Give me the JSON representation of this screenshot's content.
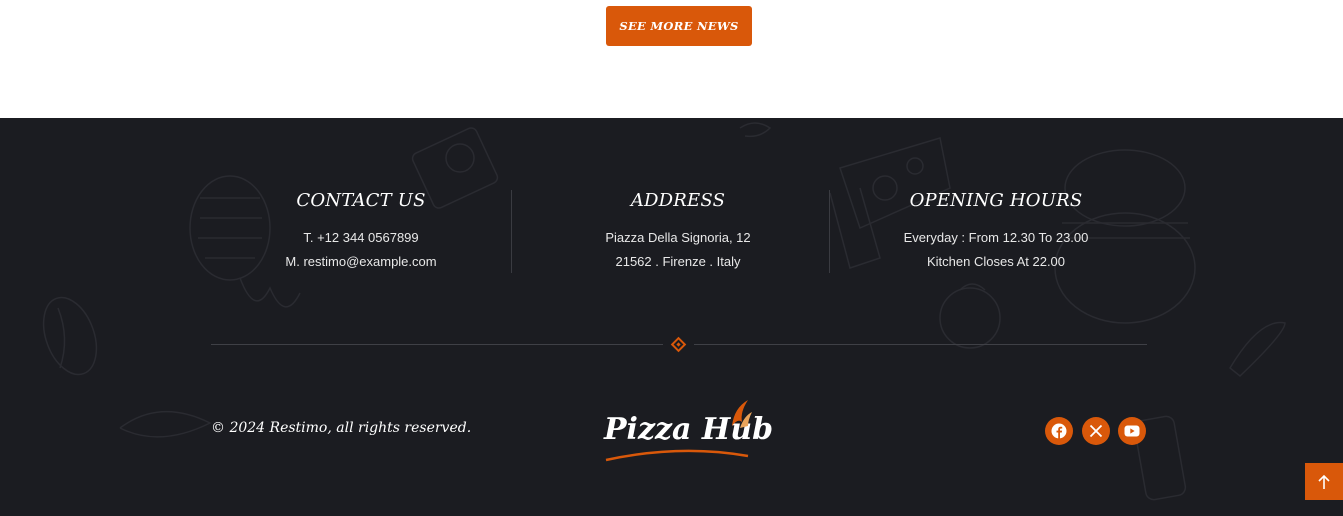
{
  "cta": {
    "see_more_label": "SEE MORE NEWS"
  },
  "footer": {
    "contact": {
      "title": "CONTACT US",
      "phone": "T. +12 344 0567899",
      "email": "M. restimo@example.com"
    },
    "address": {
      "title": "ADDRESS",
      "line1": "Piazza Della Signoria, 12",
      "line2": "21562 . Firenze . Italy"
    },
    "hours": {
      "title": "OPENING HOURS",
      "line1": "Everyday : From 12.30 To 23.00",
      "line2": "Kitchen Closes At 22.00"
    },
    "copyright": "© 2024 Restimo, all rights reserved.",
    "logo_text": "Pizza Hub",
    "social": [
      {
        "icon": "facebook-icon"
      },
      {
        "icon": "x-twitter-icon"
      },
      {
        "icon": "youtube-icon"
      }
    ],
    "scroll_top_icon": "arrow-up-icon"
  },
  "colors": {
    "accent": "#d9580a",
    "footer_bg": "#1b1c21",
    "text": "#ffffff"
  }
}
